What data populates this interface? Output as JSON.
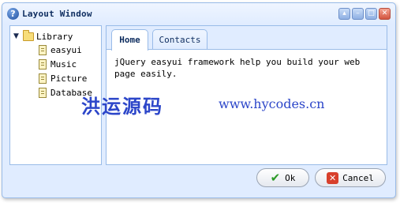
{
  "window": {
    "title": "Layout Window"
  },
  "tools": {
    "collapse_glyph": "▴",
    "minimize_glyph": "–",
    "maximize_glyph": "□",
    "close_glyph": "✕"
  },
  "tree": {
    "root": {
      "label": "Library",
      "icon": "folder-open-icon"
    },
    "children": [
      {
        "label": "easyui",
        "icon": "file-icon"
      },
      {
        "label": "Music",
        "icon": "file-icon"
      },
      {
        "label": "Picture",
        "icon": "file-icon"
      },
      {
        "label": "Database",
        "icon": "file-icon"
      }
    ]
  },
  "tabs": [
    {
      "label": "Home",
      "selected": true
    },
    {
      "label": "Contacts",
      "selected": false
    }
  ],
  "content": {
    "text": "jQuery easyui framework help you build your web page easily."
  },
  "watermark": {
    "cn": "洪运源码",
    "url": "www.hycodes.cn"
  },
  "buttons": {
    "ok_label": "Ok",
    "cancel_label": "Cancel"
  },
  "colors": {
    "border": "#99bbe8",
    "panel_header": "#e0ecff",
    "title_text": "#0e2d5f",
    "watermark": "#2c46c9"
  }
}
